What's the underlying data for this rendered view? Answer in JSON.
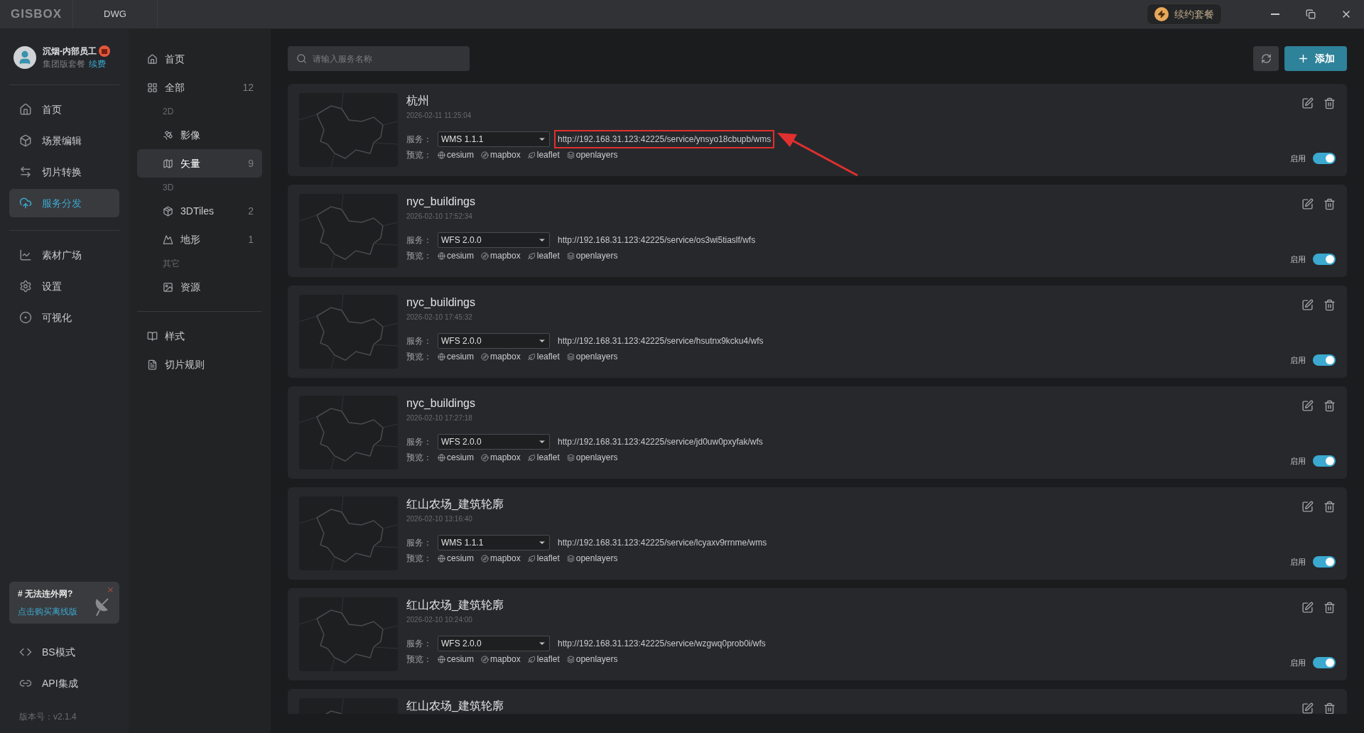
{
  "titlebar": {
    "logo": "GISBOX",
    "tabs": [
      {
        "label": "DWG"
      }
    ],
    "renew_button": "续约套餐"
  },
  "user": {
    "name": "沉烟-内部员工",
    "plan": "集团版套餐",
    "renew_link": "续费"
  },
  "nav_groups": [
    [
      {
        "label": "首页",
        "selected": false
      },
      {
        "label": "场景编辑",
        "selected": false
      },
      {
        "label": "切片转换",
        "selected": false
      },
      {
        "label": "服务分发",
        "selected": true
      }
    ],
    [
      {
        "label": "素材广场",
        "selected": false
      },
      {
        "label": "设置",
        "selected": false
      },
      {
        "label": "可视化",
        "selected": false
      }
    ]
  ],
  "promo": {
    "title": "# 无法连外网?",
    "link": "点击购买离线版"
  },
  "nav_bottom": [
    {
      "label": "BS模式"
    },
    {
      "label": "API集成"
    }
  ],
  "version": "版本号：v2.1.4",
  "categories": [
    {
      "label": "首页",
      "selected": false
    },
    {
      "label": "全部",
      "count": "12",
      "selected": false,
      "children": [
        {
          "label": "2D",
          "kind": "heading",
          "children": [
            {
              "label": "影像",
              "selected": false
            },
            {
              "label": "矢量",
              "count": "9",
              "selected": true
            }
          ]
        },
        {
          "label": "3D",
          "kind": "heading",
          "children": [
            {
              "label": "3DTiles",
              "count": "2",
              "selected": false
            },
            {
              "label": "地形",
              "count": "1",
              "selected": false
            }
          ]
        },
        {
          "label": "其它",
          "kind": "heading",
          "children": [
            {
              "label": "资源",
              "selected": false
            }
          ]
        }
      ]
    }
  ],
  "categories_bottom": [
    {
      "label": "样式",
      "selected": false
    },
    {
      "label": "切片规则",
      "selected": false
    }
  ],
  "search": {
    "placeholder": "请输入服务名称"
  },
  "add_button": "添加",
  "services": [
    {
      "title": "杭州",
      "date": "2026-02-11 11:25:04",
      "service_label": "服务：",
      "protocol": "WMS 1.1.1",
      "url": "http://192.168.31.123:42225/service/ynsyo18cbupb/wms",
      "annotated": true,
      "preview_label": "预览：",
      "previews": [
        "cesium",
        "mapbox",
        "leaflet",
        "openlayers"
      ],
      "enabled_label": "启用",
      "enabled": true
    },
    {
      "title": "nyc_buildings",
      "date": "2026-02-10 17:52:34",
      "service_label": "服务：",
      "protocol": "WFS 2.0.0",
      "url": "http://192.168.31.123:42225/service/os3wi5tiaslf/wfs",
      "annotated": false,
      "preview_label": "预览：",
      "previews": [
        "cesium",
        "mapbox",
        "leaflet",
        "openlayers"
      ],
      "enabled_label": "启用",
      "enabled": true
    },
    {
      "title": "nyc_buildings",
      "date": "2026-02-10 17:45:32",
      "service_label": "服务：",
      "protocol": "WFS 2.0.0",
      "url": "http://192.168.31.123:42225/service/hsutnx9kcku4/wfs",
      "annotated": false,
      "preview_label": "预览：",
      "previews": [
        "cesium",
        "mapbox",
        "leaflet",
        "openlayers"
      ],
      "enabled_label": "启用",
      "enabled": true
    },
    {
      "title": "nyc_buildings",
      "date": "2026-02-10 17:27:18",
      "service_label": "服务：",
      "protocol": "WFS 2.0.0",
      "url": "http://192.168.31.123:42225/service/jd0uw0pxyfak/wfs",
      "annotated": false,
      "preview_label": "预览：",
      "previews": [
        "cesium",
        "mapbox",
        "leaflet",
        "openlayers"
      ],
      "enabled_label": "启用",
      "enabled": true
    },
    {
      "title": "红山农场_建筑轮廓",
      "date": "2026-02-10 13:16:40",
      "service_label": "服务：",
      "protocol": "WMS 1.1.1",
      "url": "http://192.168.31.123:42225/service/lcyaxv9rrnme/wms",
      "annotated": false,
      "preview_label": "预览：",
      "previews": [
        "cesium",
        "mapbox",
        "leaflet",
        "openlayers"
      ],
      "enabled_label": "启用",
      "enabled": true
    },
    {
      "title": "红山农场_建筑轮廓",
      "date": "2026-02-10 10:24:00",
      "service_label": "服务：",
      "protocol": "WFS 2.0.0",
      "url": "http://192.168.31.123:42225/service/wzgwq0prob0i/wfs",
      "annotated": false,
      "preview_label": "预览：",
      "previews": [
        "cesium",
        "mapbox",
        "leaflet",
        "openlayers"
      ],
      "enabled_label": "启用",
      "enabled": true
    },
    {
      "title": "红山农场_建筑轮廓"
    }
  ]
}
